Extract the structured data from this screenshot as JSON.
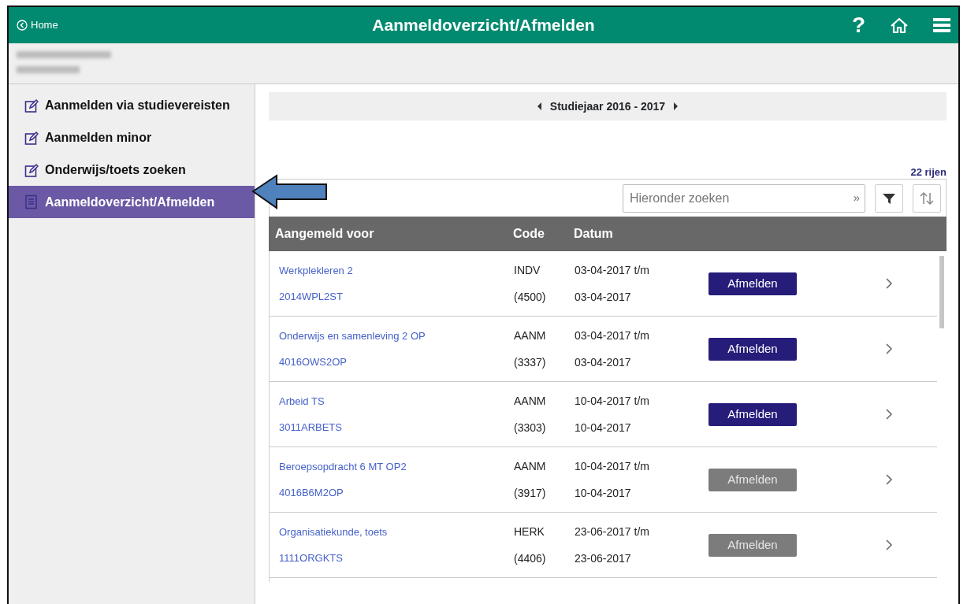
{
  "header": {
    "back_link": "Home",
    "title": "Aanmeldoverzicht/Afmelden",
    "help": "?"
  },
  "sidebar": {
    "items": [
      {
        "label": "Aanmelden via studievereisten",
        "kind": "edit",
        "selected": false
      },
      {
        "label": "Aanmelden minor",
        "kind": "edit",
        "selected": false
      },
      {
        "label": "Onderwijs/toets zoeken",
        "kind": "edit",
        "selected": false
      },
      {
        "label": "Aanmeldoverzicht/Afmelden",
        "kind": "list",
        "selected": true
      }
    ]
  },
  "year_selector": {
    "label": "Studiejaar 2016 - 2017"
  },
  "row_count": "22 rijen",
  "search": {
    "placeholder": "Hieronder zoeken",
    "submit": "»"
  },
  "table": {
    "columns": [
      "Aangemeld voor",
      "Code",
      "Datum"
    ],
    "rows": [
      {
        "name": "Werkplekleren 2",
        "course_code": "2014WPL2ST",
        "type": "INDV",
        "number": "(4500)",
        "date_from": "03-04-2017 t/m",
        "date_to": "03-04-2017",
        "action": "Afmelden",
        "disabled": false
      },
      {
        "name": "Onderwijs en samenleving 2 OP",
        "course_code": "4016OWS2OP",
        "type": "AANM",
        "number": "(3337)",
        "date_from": "03-04-2017 t/m",
        "date_to": "03-04-2017",
        "action": "Afmelden",
        "disabled": false
      },
      {
        "name": "Arbeid TS",
        "course_code": "3011ARBETS",
        "type": "AANM",
        "number": "(3303)",
        "date_from": "10-04-2017 t/m",
        "date_to": "10-04-2017",
        "action": "Afmelden",
        "disabled": false
      },
      {
        "name": "Beroepsopdracht 6 MT OP2",
        "course_code": "4016B6M2OP",
        "type": "AANM",
        "number": "(3917)",
        "date_from": "10-04-2017 t/m",
        "date_to": "10-04-2017",
        "action": "Afmelden",
        "disabled": true
      },
      {
        "name": "Organisatiekunde, toets",
        "course_code": "1111ORGKTS",
        "type": "HERK",
        "number": "(4406)",
        "date_from": "23-06-2017 t/m",
        "date_to": "23-06-2017",
        "action": "Afmelden",
        "disabled": true
      }
    ]
  }
}
